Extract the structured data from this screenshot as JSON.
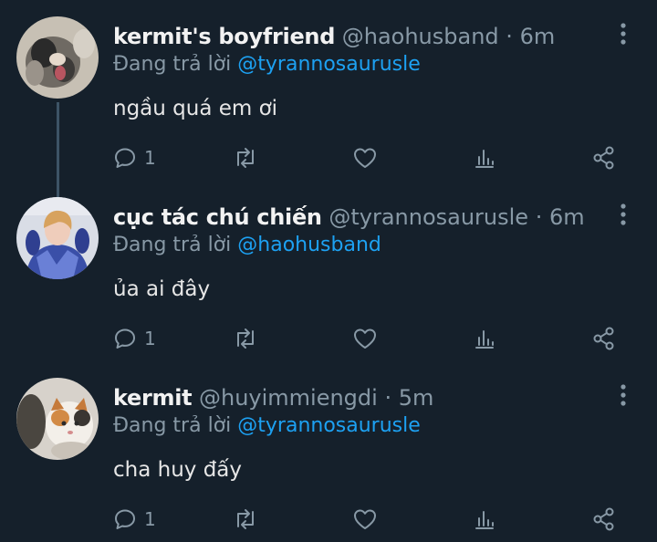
{
  "colors": {
    "background": "#15202b",
    "name": "#f2f2f2",
    "secondary": "#8899a6",
    "mention": "#1da1f2",
    "thread_line": "#3d5466"
  },
  "tweets": [
    {
      "avatar_icon": "cat-photo-avatar",
      "name": "kermit's boyfriend",
      "handle": "@haohusband",
      "time": "6m",
      "reply_prefix": "Đang trả lời",
      "reply_to": "@tyrannosaurusle",
      "text": "ngầu quá em ơi",
      "reply_count": "1"
    },
    {
      "avatar_icon": "person-photo-avatar",
      "name": "cục tác chú chiến",
      "handle": "@tyrannosaurusle",
      "time": "6m",
      "reply_prefix": "Đang trả lời",
      "reply_to": "@haohusband",
      "text": "ủa ai đây",
      "reply_count": "1"
    },
    {
      "avatar_icon": "cat-photo-avatar",
      "name": "kermit",
      "handle": "@huyimmiengdi",
      "time": "5m",
      "reply_prefix": "Đang trả lời",
      "reply_to": "@tyrannosaurusle",
      "text": "cha huy đấy",
      "reply_count": "1"
    }
  ]
}
